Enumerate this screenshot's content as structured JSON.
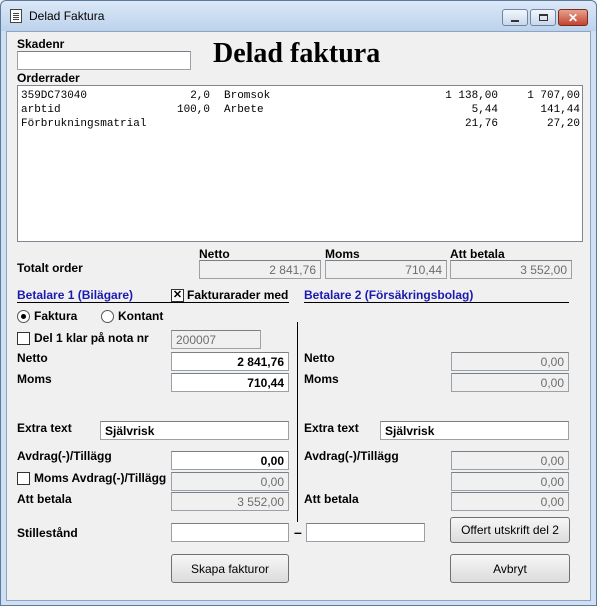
{
  "window": {
    "title": "Delad Faktura"
  },
  "header": {
    "skadenr_label": "Skadenr",
    "skadenr_value": "",
    "heading": "Delad faktura"
  },
  "orderrader": {
    "label": "Orderrader",
    "rows": [
      {
        "code": "359DC73040",
        "qty": "2,0",
        "desc": "Bromsok",
        "price": "1 138,00",
        "sum": "1 707,00"
      },
      {
        "code": "arbtid",
        "qty": "100,0",
        "desc": "Arbete",
        "price": "5,44",
        "sum": "141,44"
      },
      {
        "code": "Förbrukningsmatrial",
        "qty": "",
        "desc": "",
        "price": "21,76",
        "sum": "27,20"
      }
    ]
  },
  "totals": {
    "row_label": "Totalt order",
    "netto_label": "Netto",
    "netto": "2 841,76",
    "moms_label": "Moms",
    "moms": "710,44",
    "att_label": "Att betala",
    "att": "3 552,00"
  },
  "payer1": {
    "header": "Betalare 1 (Bilägare)",
    "fakturarader_label": "Fakturarader med",
    "fakturarader_checked": true,
    "radio_faktura": "Faktura",
    "radio_kontant": "Kontant",
    "selected": "Faktura",
    "del1_label": "Del 1 klar på nota nr",
    "del1_checked": false,
    "nota_nr": "200007",
    "netto_label": "Netto",
    "netto": "2 841,76",
    "moms_label": "Moms",
    "moms": "710,44",
    "extra_label": "Extra text",
    "extra": "Självrisk",
    "avdrag_label": "Avdrag(-)/Tillägg",
    "avdrag": "0,00",
    "momsavdrag_label": "Moms Avdrag(-)/Tillägg",
    "momsavdrag_checked": false,
    "momsavdrag": "0,00",
    "att_label": "Att betala",
    "att": "3 552,00"
  },
  "payer2": {
    "header": "Betalare 2 (Försäkringsbolag)",
    "netto_label": "Netto",
    "netto": "0,00",
    "moms_label": "Moms",
    "moms": "0,00",
    "extra_label": "Extra text",
    "extra": "Självrisk",
    "avdrag_label": "Avdrag(-)/Tillägg",
    "avdrag": "0,00",
    "momsavdrag": "0,00",
    "att_label": "Att betala",
    "att": "0,00"
  },
  "stillestand": {
    "label": "Stillestånd",
    "from": "",
    "dash": "–",
    "to": ""
  },
  "buttons": {
    "offert": "Offert utskrift del 2",
    "skapa": "Skapa fakturor",
    "avbryt": "Avbryt"
  },
  "icons": {
    "app": "document-icon",
    "minimize": "minimize-icon",
    "maximize": "maximize-icon",
    "close": "close-icon"
  }
}
